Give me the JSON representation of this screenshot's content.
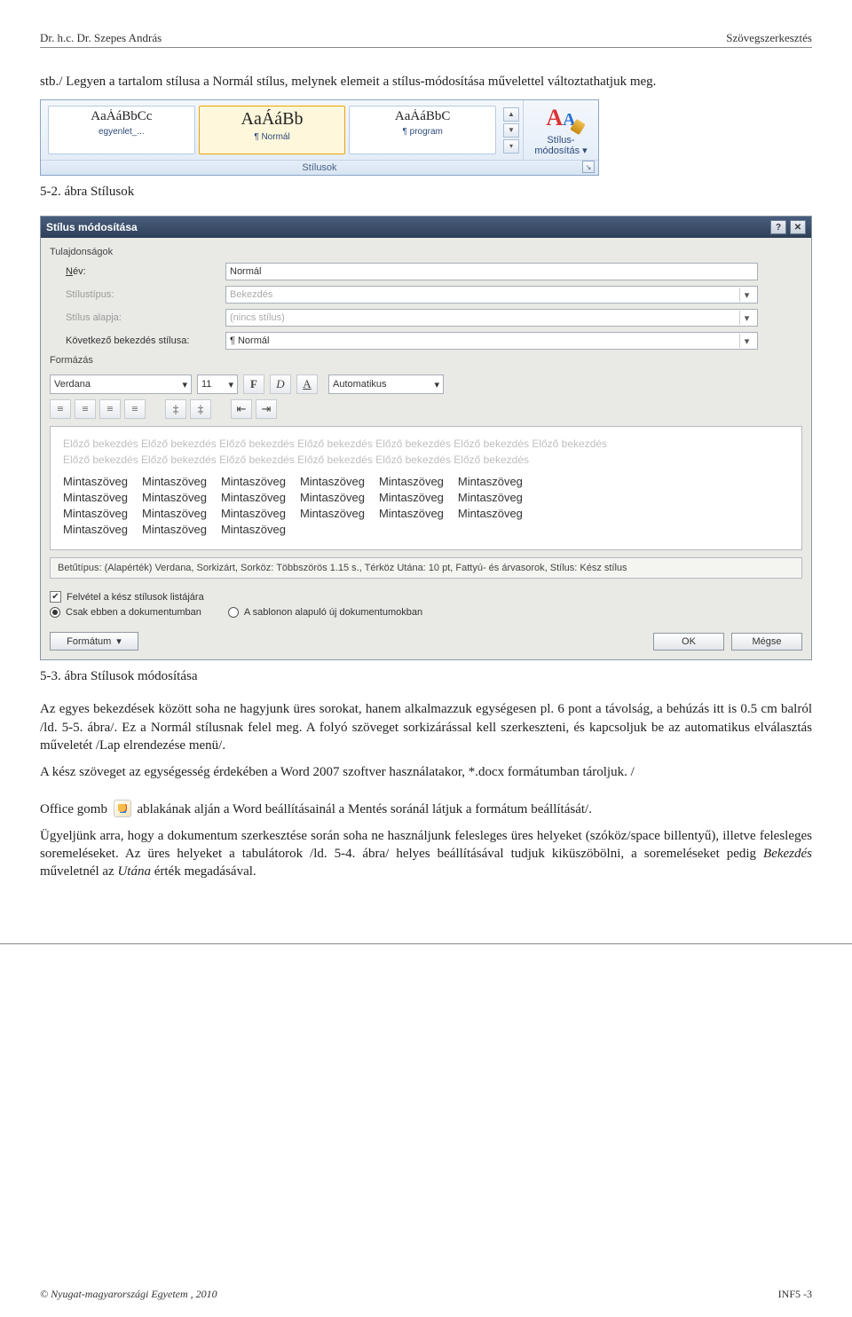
{
  "header": {
    "left": "Dr. h.c. Dr. Szepes András",
    "right": "Szövegszerkesztés"
  },
  "intro": "stb./ Legyen a tartalom stílusa a Normál stílus, melynek elemeit a stílus-módosítása művelettel változtathatjuk meg.",
  "ribbon": {
    "thumbs": [
      {
        "preview": "AaÁáBbCc",
        "name": "egyenlet_..."
      },
      {
        "preview": "AaÁáBb",
        "name": "¶ Normál",
        "big": true,
        "selected": true
      },
      {
        "preview": "AaÁáBbC",
        "name": "¶ program"
      }
    ],
    "modositas_top": "Stílus-",
    "modositas_bottom": "módosítás",
    "group_label": "Stílusok"
  },
  "fig52": "5-2. ábra Stílusok",
  "dialog": {
    "title": "Stílus módosítása",
    "fields_section": "Tulajdonságok",
    "name_label": "Név:",
    "name_value": "Normál",
    "type_label": "Stílustípus:",
    "type_value": "Bekezdés",
    "basedon_label": "Stílus alapja:",
    "basedon_value": "(nincs stílus)",
    "next_label": "Következő bekezdés stílusa:",
    "next_value": "¶ Normál",
    "format_section": "Formázás",
    "font_name": "Verdana",
    "font_size": "11",
    "auto": "Automatikus",
    "ghost1": "Előző bekezdés Előző bekezdés Előző bekezdés Előző bekezdés Előző bekezdés Előző bekezdés Előző bekezdés",
    "ghost2": "Előző bekezdés Előző bekezdés Előző bekezdés Előző bekezdés Előző bekezdés Előző bekezdés",
    "sample": "Mintaszöveg",
    "summary": "Betűtípus: (Alapérték) Verdana, Sorkizárt, Sorköz:  Többszörös 1.15 s.,  Térköz Utána:  10 pt, Fattyú- és árvasorok, Stílus: Kész stílus",
    "chk_add": "Felvétel a kész stílusok listájára",
    "radio_this": "Csak ebben a dokumentumban",
    "radio_tpl": "A sablonon alapuló új dokumentumokban",
    "btn_format": "Formátum",
    "btn_ok": "OK",
    "btn_cancel": "Mégse"
  },
  "fig53": "5-3. ábra Stílusok módosítása",
  "p1": "Az egyes bekezdések között soha ne hagyjunk üres sorokat, hanem alkalmazzuk egységesen pl. 6 pont a távolság, a behúzás itt is 0.5 cm balról /ld. 5-5. ábra/. Ez a Normál stílusnak felel meg. A folyó szöveget sorkizárással kell szerkeszteni, és kapcsoljuk be az automatikus elválasztás műveletét /Lap elrendezése menü/.",
  "p2_a": "A kész szöveget az egységesség érdekében a Word 2007 szoftver használatakor, *.docx formátumban tároljuk. /",
  "p2_b": "Office gomb",
  "p2_c": " ablakának alján a Word beállításainál a Mentés soránál látjuk a formátum beállítását/.",
  "p3_a": "Ügyeljünk arra, hogy a dokumentum szerkesztése során soha ne használjunk felesleges üres helyeket (szóköz/space billentyű), illetve felesleges soremeléseket. Az üres helyeket a tabulátorok /ld. 5-4. ábra/ helyes beállításával tudjuk kiküszöbölni, a soremeléseket pedig ",
  "p3_b": "Bekezdés",
  "p3_c": " műveletnél az ",
  "p3_d": "Utána",
  "p3_e": " érték megadásával.",
  "footer": {
    "left": "© Nyugat-magyarországi Egyetem , 2010",
    "right": "INF5 -3"
  }
}
